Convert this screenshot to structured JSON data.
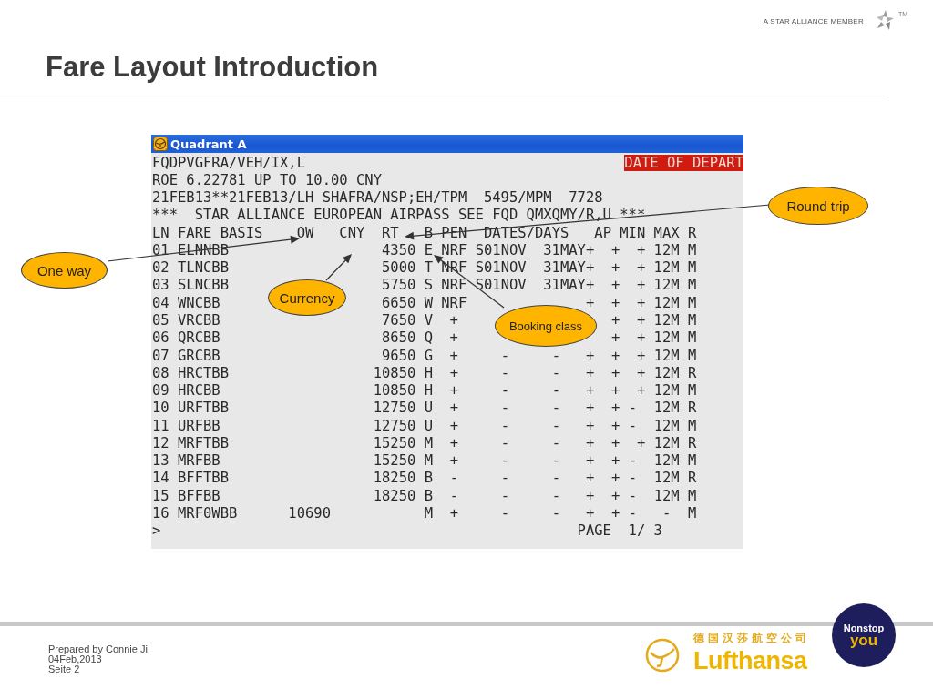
{
  "header": {
    "alliance_text": "A STAR ALLIANCE MEMBER",
    "trademark": "TM"
  },
  "slide_title": "Fare Layout Introduction",
  "terminal": {
    "title": "Quadrant A",
    "highlight": "DATE OF DEPART",
    "lines": [
      "FQDPVGFRA/VEH/IX,L",
      "ROE 6.22781 UP TO 10.00 CNY",
      "21FEB13**21FEB13/LH SHAFRA/NSP;EH/TPM  5495/MPM  7728",
      "***  STAR ALLIANCE EUROPEAN AIRPASS SEE FQD QMXQMY/R,U ***",
      "LN FARE BASIS    OW   CNY  RT   B PEN  DATES/DAYS   AP MIN MAX R",
      "01 ELNNBB                  4350 E NRF S01NOV  31MAY+  +  + 12M M",
      "02 TLNCBB                  5000 T NRF S01NOV  31MAY+  +  + 12M M",
      "03 SLNCBB                  5750 S NRF S01NOV  31MAY+  +  + 12M M",
      "04 WNCBB                   6650 W NRF              +  +  + 12M M",
      "05 VRCBB                   7650 V  +                  +  + 12M M",
      "06 QRCBB                   8650 Q  +                  +  + 12M M",
      "07 GRCBB                   9650 G  +     -     -   +  +  + 12M M",
      "08 HRCTBB                 10850 H  +     -     -   +  +  + 12M R",
      "09 HRCBB                  10850 H  +     -     -   +  +  + 12M M",
      "10 URFTBB                 12750 U  +     -     -   +  + -  12M R",
      "11 URFBB                  12750 U  +     -     -   +  + -  12M M",
      "12 MRFTBB                 15250 M  +     -     -   +  +  + 12M R",
      "13 MRFBB                  15250 M  +     -     -   +  + -  12M M",
      "14 BFFTBB                 18250 B  -     -     -   +  + -  12M R",
      "15 BFFBB                  18250 B  -     -     -   +  + -  12M M",
      "16 MRF0WBB      10690           M  +     -     -   +  + -   -  M",
      ">                                                 PAGE  1/ 3"
    ]
  },
  "callouts": [
    {
      "label": "One way"
    },
    {
      "label": "Currency"
    },
    {
      "label": "Booking class"
    },
    {
      "label": "Round trip"
    }
  ],
  "footer": {
    "lines": [
      "Prepared by Connie Ji",
      "04Feb,2013",
      "Seite 2"
    ],
    "chinese_name": "德国汉莎航空公司",
    "brand": "Lufthansa",
    "badge_top": "Nonstop",
    "badge_bottom": "you"
  }
}
